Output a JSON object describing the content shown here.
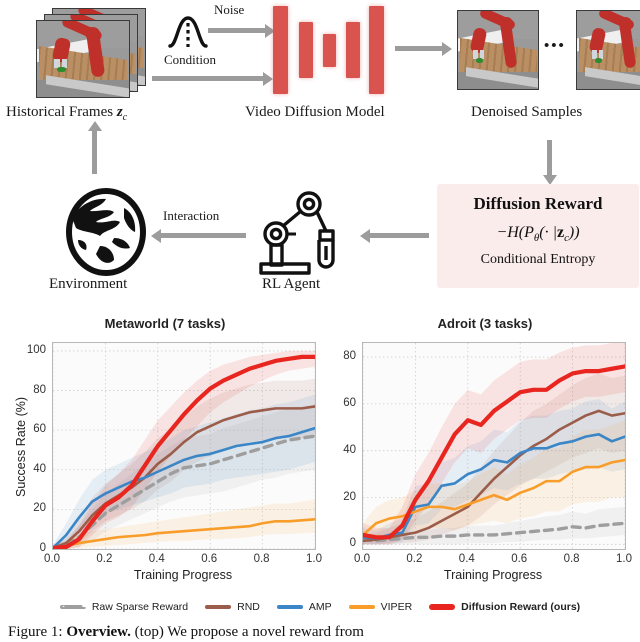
{
  "diagram": {
    "nodes": {
      "historical_frames": "Historical Frames",
      "historical_frames_sym": "z",
      "historical_frames_sub": "c",
      "video_diffusion_model": "Video Diffusion Model",
      "denoised_samples": "Denoised Samples",
      "ellipsis": "•••",
      "environment": "Environment",
      "rl_agent": "RL Agent"
    },
    "edges": {
      "noise": "Noise",
      "condition": "Condition",
      "interaction": "Interaction"
    },
    "reward_box": {
      "title": "Diffusion Reward",
      "equation": "−H(Pθ(· |z_c))",
      "eq_parts": {
        "minus_h": "−H(P",
        "theta": "θ",
        "mid": "(· |",
        "z": "z",
        "c": "c",
        "close": "))"
      },
      "subtitle": "Conditional Entropy",
      "bg_color": "#fbecec"
    },
    "colors": {
      "arrow": "#9c9c9c",
      "unet_bar": "#d9534f",
      "robot_red": "#c0302b"
    },
    "unet_bars": [
      62,
      44,
      27,
      44,
      66
    ]
  },
  "legend": {
    "items": [
      {
        "label": "Raw Sparse Reward",
        "color": "#9e9e9e",
        "style": "dashed",
        "bold": false
      },
      {
        "label": "RND",
        "color": "#9b5c4a",
        "style": "solid",
        "bold": false
      },
      {
        "label": "AMP",
        "color": "#3b86c6",
        "style": "solid",
        "bold": false
      },
      {
        "label": "VIPER",
        "color": "#f89d2a",
        "style": "solid",
        "bold": false
      },
      {
        "label": "Diffusion Reward (ours)",
        "color": "#e8251f",
        "style": "solid",
        "bold": true
      }
    ]
  },
  "caption": {
    "prefix": "Figure 1:",
    "bold_lead": "Overview.",
    "text": "(top) We propose a novel reward from"
  },
  "chart_data": [
    {
      "type": "line",
      "title": "Metaworld (7 tasks)",
      "xlabel": "Training Progress",
      "ylabel": "Success Rate (%)",
      "xlim": [
        0.0,
        1.0
      ],
      "ylim": [
        0,
        104
      ],
      "xticks": [
        "0.0",
        "0.2",
        "0.4",
        "0.6",
        "0.8",
        "1.0"
      ],
      "xtick_values": [
        0.0,
        0.2,
        0.4,
        0.6,
        0.8,
        1.0
      ],
      "yticks": [
        "0",
        "20",
        "40",
        "60",
        "80",
        "100"
      ],
      "ytick_values": [
        0,
        20,
        40,
        60,
        80,
        100
      ],
      "grid": true,
      "legend_position": "below-figure",
      "x": [
        0.0,
        0.05,
        0.1,
        0.15,
        0.2,
        0.25,
        0.3,
        0.35,
        0.4,
        0.45,
        0.5,
        0.55,
        0.6,
        0.65,
        0.7,
        0.75,
        0.8,
        0.85,
        0.9,
        0.95,
        1.0
      ],
      "series": [
        {
          "name": "Raw Sparse Reward",
          "color": "#9e9e9e",
          "style": "dashed",
          "values": [
            0.5,
            2,
            6,
            12,
            18,
            22,
            26,
            30,
            34,
            38,
            41,
            42,
            43,
            45,
            47,
            49,
            51,
            53,
            55,
            56,
            57
          ],
          "band_lo": [
            0,
            0,
            1,
            4,
            9,
            12,
            15,
            18,
            21,
            24,
            26,
            27,
            28,
            29,
            31,
            33,
            35,
            36,
            38,
            39,
            40
          ],
          "band_hi": [
            2,
            5,
            12,
            20,
            28,
            33,
            38,
            43,
            48,
            52,
            56,
            57,
            58,
            61,
            63,
            65,
            67,
            69,
            71,
            72,
            73
          ]
        },
        {
          "name": "RND",
          "color": "#9b5c4a",
          "style": "solid",
          "values": [
            0.5,
            3,
            9,
            17,
            23,
            27,
            31,
            36,
            43,
            48,
            54,
            59,
            62,
            65,
            67,
            69,
            70,
            71,
            71,
            71,
            72
          ],
          "band_lo": [
            0,
            0,
            3,
            9,
            14,
            17,
            20,
            24,
            30,
            34,
            40,
            44,
            47,
            50,
            52,
            54,
            55,
            56,
            56,
            56,
            57
          ],
          "band_hi": [
            2,
            7,
            16,
            26,
            33,
            38,
            43,
            49,
            56,
            61,
            67,
            72,
            76,
            79,
            81,
            83,
            84,
            85,
            85,
            85,
            86
          ]
        },
        {
          "name": "AMP",
          "color": "#3b86c6",
          "style": "solid",
          "values": [
            0.5,
            7,
            16,
            24,
            28,
            31,
            34,
            36,
            39,
            42,
            45,
            47,
            48,
            50,
            52,
            53,
            54,
            56,
            57,
            59,
            61
          ],
          "band_lo": [
            0,
            2,
            8,
            14,
            18,
            20,
            22,
            24,
            26,
            28,
            31,
            32,
            33,
            35,
            36,
            37,
            38,
            39,
            40,
            42,
            44
          ],
          "band_hi": [
            2,
            13,
            25,
            35,
            40,
            43,
            46,
            49,
            52,
            56,
            60,
            62,
            64,
            66,
            68,
            70,
            71,
            73,
            74,
            76,
            78
          ]
        },
        {
          "name": "VIPER",
          "color": "#f89d2a",
          "style": "solid",
          "values": [
            0.3,
            1.5,
            3,
            4,
            5,
            6,
            6.5,
            7,
            8,
            8.5,
            9,
            9.5,
            10,
            10.5,
            11,
            11.5,
            13,
            14,
            14,
            14.5,
            15
          ],
          "band_lo": [
            0,
            0,
            0.5,
            1,
            1.5,
            2,
            2.5,
            3,
            3.5,
            4,
            4,
            4.5,
            5,
            5,
            5.5,
            6,
            7,
            7.5,
            7.5,
            8,
            8
          ],
          "band_hi": [
            1,
            4,
            7,
            9,
            10,
            11,
            12,
            13,
            14,
            15,
            16,
            17,
            18,
            19,
            20,
            21,
            22,
            23,
            23,
            24,
            25
          ]
        },
        {
          "name": "Diffusion Reward (ours)",
          "color": "#e8251f",
          "style": "solid",
          "values": [
            0.5,
            1,
            5,
            14,
            22,
            26,
            32,
            42,
            52,
            60,
            68,
            75,
            81,
            85,
            88,
            91,
            93,
            95,
            96,
            97,
            97
          ],
          "band_lo": [
            0,
            0,
            1,
            7,
            13,
            16,
            21,
            30,
            39,
            47,
            55,
            62,
            69,
            74,
            78,
            82,
            85,
            88,
            90,
            91,
            92
          ],
          "band_hi": [
            2,
            4,
            12,
            23,
            32,
            38,
            45,
            55,
            65,
            72,
            79,
            85,
            90,
            93,
            95,
            97,
            98,
            99,
            100,
            100,
            100
          ]
        }
      ]
    },
    {
      "type": "line",
      "title": "Adroit (3 tasks)",
      "xlabel": "Training Progress",
      "ylabel": "",
      "xlim": [
        0.0,
        1.0
      ],
      "ylim": [
        -2,
        86
      ],
      "xticks": [
        "0.0",
        "0.2",
        "0.4",
        "0.6",
        "0.8",
        "1.0"
      ],
      "xtick_values": [
        0.0,
        0.2,
        0.4,
        0.6,
        0.8,
        1.0
      ],
      "yticks": [
        "0",
        "20",
        "40",
        "60",
        "80"
      ],
      "ytick_values": [
        0,
        20,
        40,
        60,
        80
      ],
      "grid": true,
      "legend_position": "below-figure",
      "x": [
        0.0,
        0.05,
        0.1,
        0.15,
        0.2,
        0.25,
        0.3,
        0.35,
        0.4,
        0.45,
        0.5,
        0.55,
        0.6,
        0.65,
        0.7,
        0.75,
        0.8,
        0.85,
        0.9,
        0.95,
        1.0
      ],
      "series": [
        {
          "name": "Raw Sparse Reward",
          "color": "#9e9e9e",
          "style": "dashed",
          "values": [
            2,
            1.5,
            2,
            2.5,
            3,
            3,
            3.5,
            3.5,
            4,
            4,
            4,
            4.5,
            5,
            5.5,
            6,
            6.5,
            7.5,
            7,
            8,
            8.5,
            9
          ],
          "band_lo": [
            0,
            0,
            0,
            0,
            0,
            0,
            0,
            0,
            0.5,
            0.5,
            0.5,
            1,
            1,
            1.5,
            2,
            2,
            2.5,
            2.5,
            3,
            3.5,
            4
          ],
          "band_hi": [
            5,
            4,
            5,
            5.5,
            6,
            6,
            7,
            7,
            8,
            8,
            8,
            9,
            10,
            11,
            12,
            12.5,
            14,
            13,
            15,
            15.5,
            16
          ]
        },
        {
          "name": "RND",
          "color": "#9b5c4a",
          "style": "solid",
          "values": [
            1.5,
            2,
            3,
            4,
            5,
            7,
            10,
            13,
            16,
            22,
            28,
            33,
            38,
            42,
            45,
            49,
            52,
            55,
            57,
            55,
            56
          ],
          "band_lo": [
            0,
            0,
            0,
            0.5,
            1,
            2,
            4,
            6,
            8,
            12,
            17,
            21,
            25,
            28,
            31,
            34,
            37,
            39,
            41,
            39,
            40
          ],
          "band_hi": [
            4,
            5,
            7,
            9,
            11,
            14,
            18,
            22,
            26,
            33,
            40,
            46,
            52,
            57,
            60,
            64,
            68,
            71,
            73,
            71,
            72
          ]
        },
        {
          "name": "AMP",
          "color": "#3b86c6",
          "style": "solid",
          "values": [
            3,
            2.5,
            4,
            5,
            16,
            17,
            25,
            26,
            30,
            32,
            36,
            35,
            39,
            41,
            41,
            43,
            44,
            46,
            47,
            44,
            46
          ],
          "band_lo": [
            0,
            0,
            0.5,
            1,
            8,
            9,
            15,
            16,
            19,
            21,
            24,
            23,
            26,
            28,
            28,
            30,
            31,
            32,
            33,
            31,
            32
          ],
          "band_hi": [
            7,
            6,
            9,
            11,
            25,
            26,
            35,
            37,
            42,
            44,
            49,
            48,
            53,
            55,
            55,
            57,
            58,
            61,
            62,
            58,
            61
          ]
        },
        {
          "name": "VIPER",
          "color": "#f89d2a",
          "style": "solid",
          "values": [
            4,
            9,
            11,
            12,
            14,
            16,
            16,
            15,
            17,
            19,
            21,
            19,
            22,
            24,
            27,
            27,
            31,
            33,
            33,
            35,
            36
          ],
          "band_lo": [
            0,
            3,
            4,
            5,
            6,
            7,
            7,
            6,
            8,
            9,
            10,
            9,
            11,
            12,
            14,
            14,
            17,
            18,
            18,
            20,
            20
          ],
          "band_hi": [
            9,
            16,
            19,
            20,
            23,
            26,
            26,
            25,
            27,
            30,
            33,
            30,
            34,
            37,
            41,
            41,
            46,
            49,
            49,
            51,
            53
          ]
        },
        {
          "name": "Diffusion Reward (ours)",
          "color": "#e8251f",
          "style": "solid",
          "values": [
            4,
            3,
            3,
            8,
            19,
            27,
            37,
            47,
            53,
            51,
            57,
            61,
            65,
            66,
            66,
            70,
            73,
            74,
            74,
            75,
            76
          ],
          "band_lo": [
            0,
            0,
            0,
            2,
            10,
            17,
            26,
            35,
            41,
            39,
            45,
            49,
            53,
            54,
            54,
            58,
            61,
            63,
            63,
            64,
            65
          ],
          "band_hi": [
            9,
            7,
            7,
            16,
            30,
            39,
            50,
            60,
            66,
            64,
            70,
            74,
            78,
            79,
            79,
            82,
            84,
            85,
            85,
            86,
            86
          ]
        }
      ]
    }
  ]
}
